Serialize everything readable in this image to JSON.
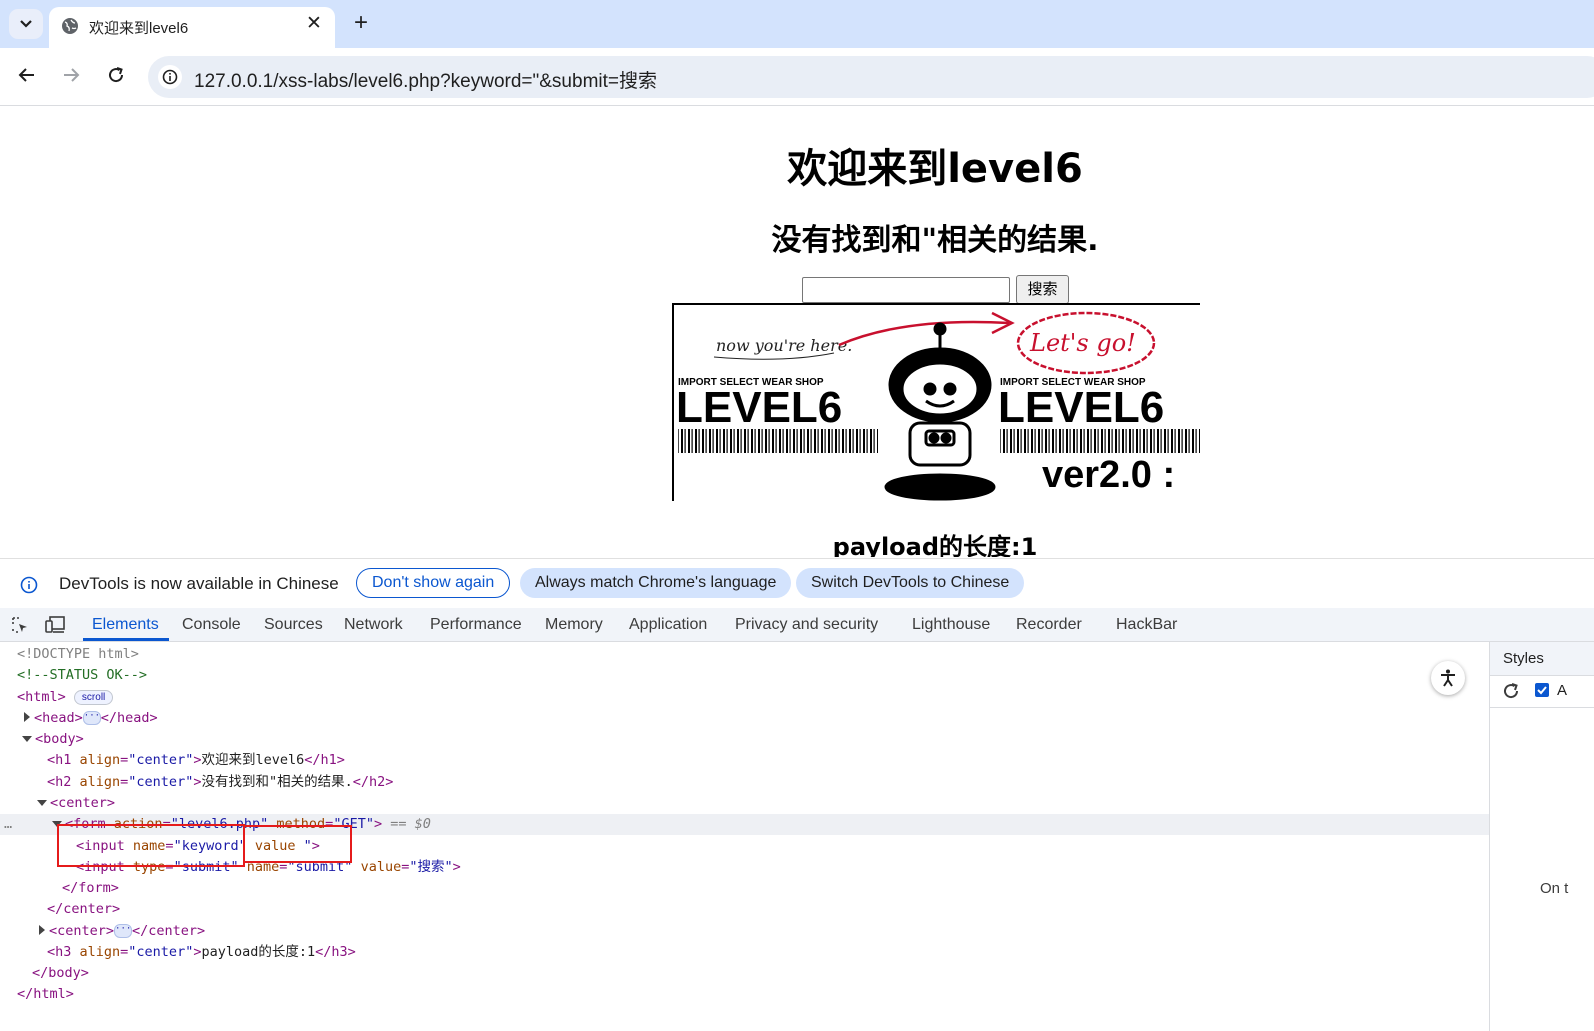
{
  "browser": {
    "tab_title": "欢迎来到level6",
    "url": "127.0.0.1/xss-labs/level6.php?keyword=\"&submit=搜索"
  },
  "page": {
    "h1": "欢迎来到level6",
    "h2": "没有找到和\"相关的结果.",
    "search_button": "搜索",
    "banner": {
      "handwritten_left": "now you're here.",
      "handwritten_right": "Let's go!",
      "shop_left": "IMPORT SELECT WEAR SHOP",
      "level_left": "LEVEL6",
      "shop_right": "IMPORT SELECT WEAR SHOP",
      "level_right": "LEVEL6",
      "version": "ver2.0 :"
    },
    "h3": "payload的长度:1"
  },
  "infobar": {
    "message": "DevTools is now available in Chinese",
    "dont_show": "Don't show again",
    "always_match": "Always match Chrome's language",
    "switch": "Switch DevTools to Chinese"
  },
  "devtools": {
    "tabs": [
      "Elements",
      "Console",
      "Sources",
      "Network",
      "Performance",
      "Memory",
      "Application",
      "Privacy and security",
      "Lighthouse",
      "Recorder",
      "HackBar"
    ],
    "styles_title": "Styles",
    "styles_checkbox_label": "A",
    "styles_cut_text": "On t",
    "dom": {
      "doctype": "<!DOCTYPE html>",
      "comment": "<!--STATUS OK-->",
      "html_open": "<html>",
      "scroll_badge": "scroll",
      "head_open": "<head>",
      "head_close": "</head>",
      "body_open": "<body>",
      "h1_open": "<h1 ",
      "h1_attr": "align",
      "h1_val": "\"center\"",
      "h1_text": "欢迎来到level6",
      "h1_close": "</h1>",
      "h2_open": "<h2 ",
      "h2_attr": "align",
      "h2_val": "\"center\"",
      "h2_text": "没有找到和\"相关的结果.",
      "h2_close": "</h2>",
      "center_open": "<center>",
      "form_open": "<form ",
      "form_attr1": "action",
      "form_val1": "\"level6.php\"",
      "form_attr2": "method",
      "form_val2": "\"GET\"",
      "form_end": ">",
      "selected_marker": "== $0",
      "input1_open": "<input ",
      "input1_attr1": "name",
      "input1_val1": "\"keyword\"",
      "input1_attr2": "value",
      "input1_val2": "\"",
      "input1_end": ">",
      "input2_open": "<input ",
      "input2_attr1": "type",
      "input2_val1": "\"submit\"",
      "input2_attr2": "name",
      "input2_val2": "\"submit\"",
      "input2_attr3": "value",
      "input2_val3": "\"搜索\"",
      "input2_end": ">",
      "form_close": "</form>",
      "center_close": "</center>",
      "center2_open": "<center>",
      "center2_close": "</center>",
      "h3_open": "<h3 ",
      "h3_attr": "align",
      "h3_val": "\"center\"",
      "h3_text": "payload的长度:1",
      "h3_close": "</h3>",
      "body_close": "</body>",
      "html_close": "</html>",
      "row_dots": "…"
    }
  },
  "colors": {
    "tabbar": "#d3e3fd",
    "accent": "#0b57d0",
    "highlight_box": "#e51b1b"
  }
}
